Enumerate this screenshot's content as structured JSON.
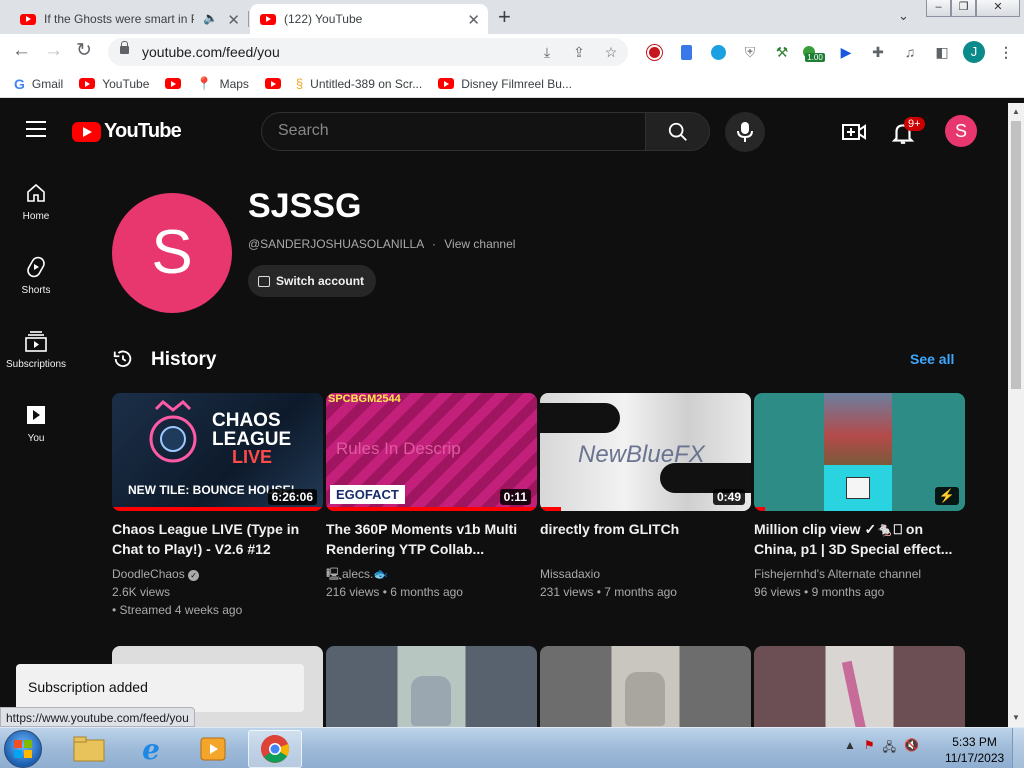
{
  "browser": {
    "tabs": [
      {
        "title": "If the Ghosts were smart in P",
        "active": false
      },
      {
        "title": "(122) YouTube",
        "active": true
      }
    ],
    "url": "youtube.com/feed/you",
    "extension_badge": "1.00",
    "profile_initial": "J",
    "bookmarks": [
      {
        "label": "Gmail",
        "icon": "gmail-icon"
      },
      {
        "label": "YouTube",
        "icon": "youtube-icon"
      },
      {
        "label": "",
        "icon": "youtube-icon"
      },
      {
        "label": "Maps",
        "icon": "maps-icon"
      },
      {
        "label": "",
        "icon": "youtube-icon"
      },
      {
        "label": "Untitled-389 on Scr...",
        "icon": "scratch-icon"
      },
      {
        "label": "Disney Filmreel Bu...",
        "icon": "youtube-icon"
      }
    ],
    "status_url": "https://www.youtube.com/feed/you"
  },
  "youtube": {
    "logo_text": "YouTube",
    "search_placeholder": "Search",
    "notification_count": "9+",
    "avatar_initial": "S",
    "sidebar": [
      {
        "label": "Home",
        "icon": "home-icon"
      },
      {
        "label": "Shorts",
        "icon": "shorts-icon"
      },
      {
        "label": "Subscriptions",
        "icon": "subscriptions-icon"
      },
      {
        "label": "You",
        "icon": "you-icon"
      }
    ],
    "channel": {
      "initial": "S",
      "name": "SJSSG",
      "handle": "@SANDERJOSHUASOLANILLA",
      "separator": "·",
      "view_channel": "View channel",
      "switch_account": "Switch account"
    },
    "history": {
      "title": "History",
      "see_all": "See all",
      "videos": [
        {
          "title": "Chaos League LIVE (Type in Chat to Play!) - V2.6 #12",
          "channel": "DoodleChaos",
          "verified": true,
          "views": "2.6K views",
          "age": "• Streamed 4 weeks ago",
          "duration": "6:26:06",
          "thumb_text_1": "CHAOS LEAGUE",
          "thumb_text_2": "LIVE",
          "thumb_text_3": "NEW TILE: BOUNCE HOUSE!"
        },
        {
          "title": "The 360P Moments v1b Multi Rendering YTP Collab...",
          "channel": "🖳alecs.🐟",
          "views": "216 views",
          "age": "6 months ago",
          "duration": "0:11",
          "thumb_text_1": "SPCBGM2544",
          "thumb_text_2": "Rules In Descrip",
          "thumb_text_3": "EGOFACT"
        },
        {
          "title": "directly from GLITCh",
          "channel": "Missadaxio",
          "views": "231 views",
          "age": "7 months ago",
          "duration": "0:49",
          "thumb_text_1": "NewBlueFX"
        },
        {
          "title": "Million clip view ✓🐁⎕ on China, p1 | 3D Special effect...",
          "channel": "Fishejernhd's Alternate channel",
          "views": "96 views",
          "age": "9 months ago",
          "duration": ""
        }
      ]
    },
    "toast": "Subscription added"
  },
  "taskbar": {
    "time": "5:33 PM",
    "date": "11/17/2023"
  }
}
